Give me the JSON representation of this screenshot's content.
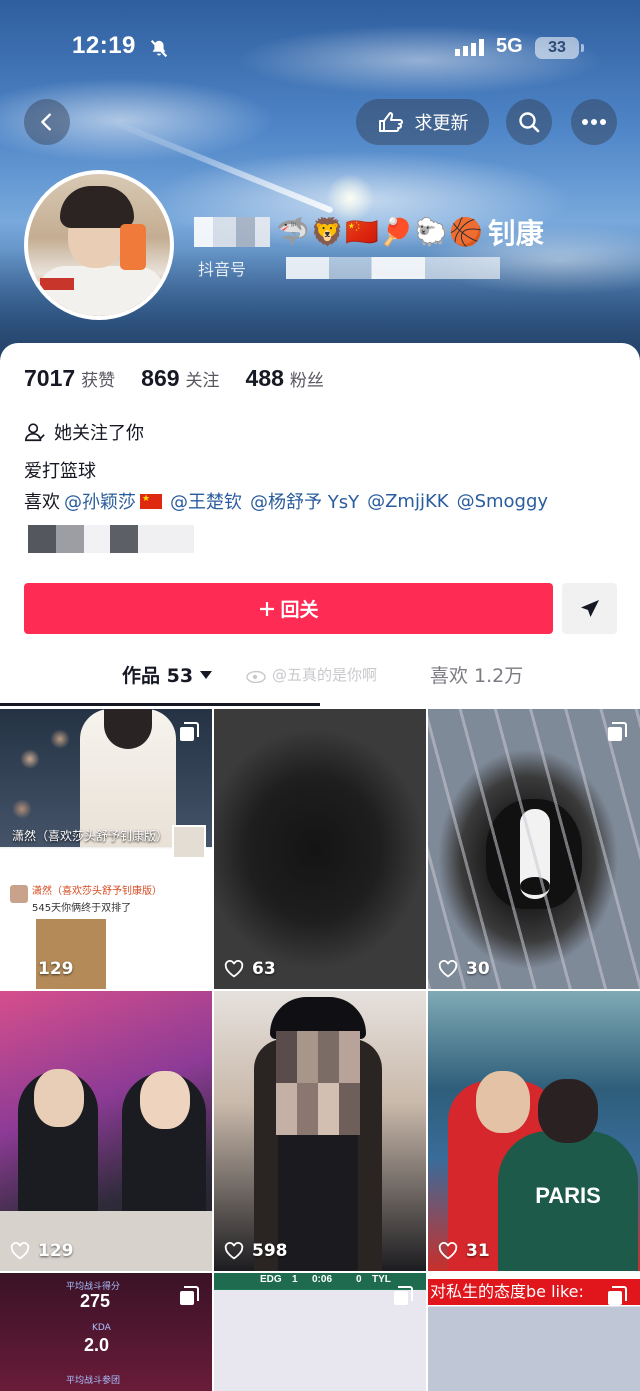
{
  "status": {
    "time": "12:19",
    "network": "5G",
    "battery": "33"
  },
  "header": {
    "update_label": "求更新"
  },
  "profile": {
    "display_name": "钊康",
    "name_emojis": "🦈🦁🇨🇳🏓🐑🏀",
    "id_label": "抖音号"
  },
  "stats": [
    {
      "value": "7017",
      "label": "获赞"
    },
    {
      "value": "869",
      "label": "关注"
    },
    {
      "value": "488",
      "label": "粉丝"
    }
  ],
  "follows_you": "她关注了你",
  "bio": "爱打篮球",
  "likes": {
    "prefix": "喜欢",
    "mentions": [
      "@孙颖莎",
      "@王楚钦",
      "@杨舒予 YsY",
      "@ZmjjKK",
      "@Smoggy"
    ]
  },
  "actions": {
    "follow_back": "回关"
  },
  "tabs": {
    "works": "作品 53",
    "liked": "喜欢 1.2万",
    "watermark": "@五真的是你啊"
  },
  "videos": [
    {
      "likes": "129",
      "caption": "潇然（喜欢莎头舒予钊康版）",
      "post_user": "潇然（喜欢莎头舒予钊康版）",
      "post_text": "545天你俩终于双排了"
    },
    {
      "likes": "63"
    },
    {
      "likes": "30"
    },
    {
      "likes": "129"
    },
    {
      "likes": "598"
    },
    {
      "likes": "31",
      "jersey": "PARIS"
    },
    {
      "stat1_label": "平均战斗得分",
      "stat1_value": "275",
      "stat2_label": "KDA",
      "stat2_value": "2.0",
      "stat3_label": "平均战斗参团"
    },
    {
      "team1": "EDG",
      "score1": "1",
      "clock": "0:06",
      "score2": "0",
      "team2": "TYL"
    },
    {
      "title": "对私生的态度be like:"
    }
  ],
  "colors": {
    "primary": "#fe2c55",
    "mention": "#2a5d9d"
  }
}
